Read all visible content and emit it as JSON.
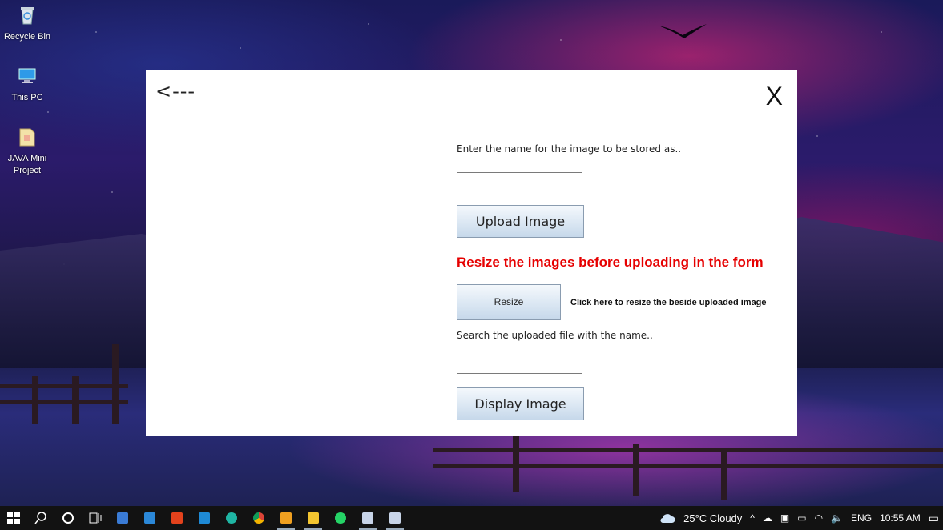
{
  "desktop": {
    "icons": [
      {
        "label": "Recycle Bin"
      },
      {
        "label": "This PC"
      },
      {
        "label": "JAVA Mini Project"
      }
    ]
  },
  "window": {
    "back_label": "<---",
    "close_label": "X",
    "name_prompt": "Enter the name for the image to be stored as..",
    "name_value": "",
    "upload_button": "Upload Image",
    "resize_warning": "Resize the images before uploading in the form",
    "resize_button": "Resize",
    "resize_hint": "Click here to resize the beside uploaded image",
    "search_prompt": "Search the uploaded file with the name..",
    "search_value": "",
    "display_button": "Display Image"
  },
  "taskbar": {
    "weather": "25°C  Cloudy",
    "language": "ENG",
    "time": "10:55 AM",
    "pinned": [
      "start-icon",
      "search-icon",
      "cortana-icon",
      "task-view-icon",
      "store-icon",
      "mail-icon",
      "office-icon",
      "vscode-icon",
      "edge-icon",
      "chrome-icon",
      "app-icon",
      "file-explorer-icon",
      "whatsapp-icon",
      "java-app-icon",
      "java-app-icon-2"
    ]
  },
  "colors": {
    "warning": "#e60000",
    "button_top": "#f4f8fc",
    "button_bottom": "#c6d8ea",
    "taskbar": "#121212"
  }
}
